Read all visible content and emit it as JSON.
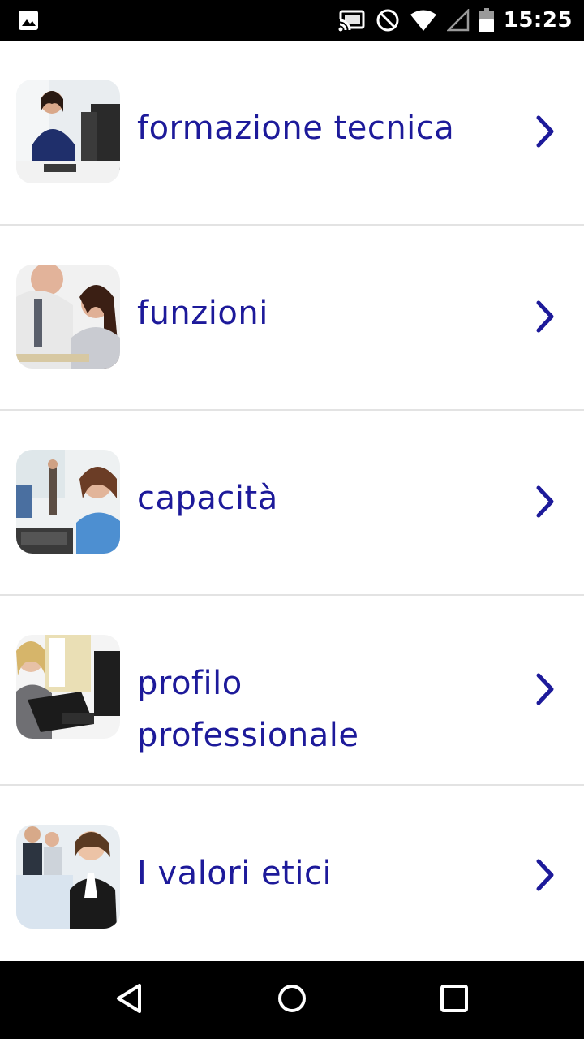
{
  "status_bar": {
    "time": "15:25",
    "icons": [
      "image-icon",
      "cast-icon",
      "do-not-disturb-icon",
      "wifi-icon",
      "signal-icon",
      "battery-icon"
    ]
  },
  "menu": {
    "items": [
      {
        "label": "formazione tecnica",
        "thumbnail": "woman-on-phone-at-desk"
      },
      {
        "label": "funzioni",
        "thumbnail": "man-and-woman-reviewing-documents"
      },
      {
        "label": "capacità",
        "thumbnail": "woman-on-phone-in-office"
      },
      {
        "label": "profilo professionale",
        "thumbnail": "woman-with-folder-at-computer"
      },
      {
        "label": "I valori etici",
        "thumbnail": "businesswoman-in-meeting"
      }
    ]
  },
  "nav_bar": {
    "buttons": [
      "back-icon",
      "home-icon",
      "recents-icon"
    ]
  },
  "colors": {
    "accent": "#1d1a9a",
    "divider": "#e3e3e3"
  }
}
